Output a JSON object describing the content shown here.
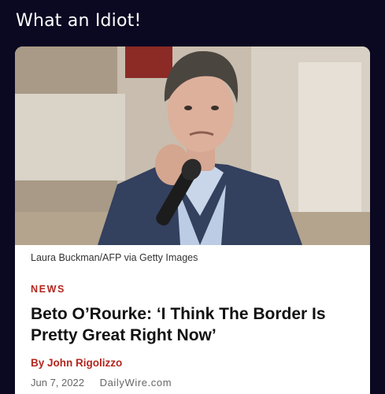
{
  "post": {
    "text": "What an Idiot!"
  },
  "article": {
    "photo_credit": "Laura Buckman/AFP via Getty Images",
    "kicker": "NEWS",
    "headline": "Beto O’Rourke: ‘I Think The Border Is Pretty Great Right Now’",
    "byline": "By John Rigolizzo",
    "date": "Jun 7, 2022",
    "source": "DailyWire.com"
  },
  "colors": {
    "background": "#0b0822",
    "card": "#ffffff",
    "accent_red": "#b3261e",
    "headline": "#111111"
  }
}
